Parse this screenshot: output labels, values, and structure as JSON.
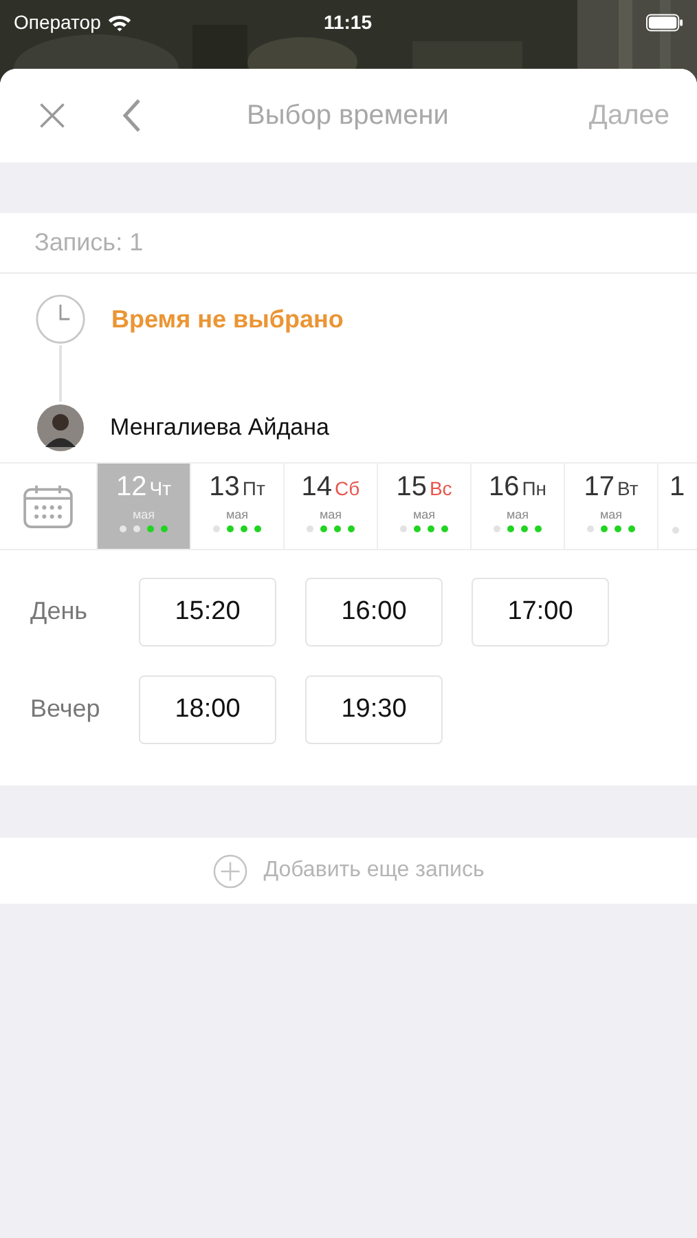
{
  "status_bar": {
    "carrier": "Оператор",
    "time": "11:15"
  },
  "nav": {
    "title": "Выбор времени",
    "next": "Далее",
    "next_disabled": true
  },
  "record": {
    "label": "Запись: 1"
  },
  "booking": {
    "time_status": "Время не выбрано",
    "specialist": "Менгалиева Айдана"
  },
  "days": [
    {
      "day": "12",
      "weekday": "Чт",
      "month": "мая",
      "selected": true,
      "dots": [
        false,
        false,
        true,
        true
      ]
    },
    {
      "day": "13",
      "weekday": "Пт",
      "month": "мая",
      "weekend": false,
      "selected": false,
      "dots": [
        false,
        true,
        true,
        true
      ]
    },
    {
      "day": "14",
      "weekday": "Сб",
      "month": "мая",
      "weekend": true,
      "selected": false,
      "dots": [
        false,
        true,
        true,
        true
      ]
    },
    {
      "day": "15",
      "weekday": "Вс",
      "month": "мая",
      "weekend": true,
      "selected": false,
      "dots": [
        false,
        true,
        true,
        true
      ]
    },
    {
      "day": "16",
      "weekday": "Пн",
      "month": "мая",
      "weekend": false,
      "selected": false,
      "dots": [
        false,
        true,
        true,
        true
      ]
    },
    {
      "day": "17",
      "weekday": "Вт",
      "month": "мая",
      "weekend": false,
      "selected": false,
      "dots": [
        false,
        true,
        true,
        true
      ]
    },
    {
      "day": "1",
      "selected": false,
      "dots": [
        false
      ]
    }
  ],
  "slot_groups": [
    {
      "label": "День",
      "slots": [
        "15:20",
        "16:00",
        "17:00"
      ]
    },
    {
      "label": "Вечер",
      "slots": [
        "18:00",
        "19:30"
      ]
    }
  ],
  "add_record": {
    "label": "Добавить еще запись"
  }
}
